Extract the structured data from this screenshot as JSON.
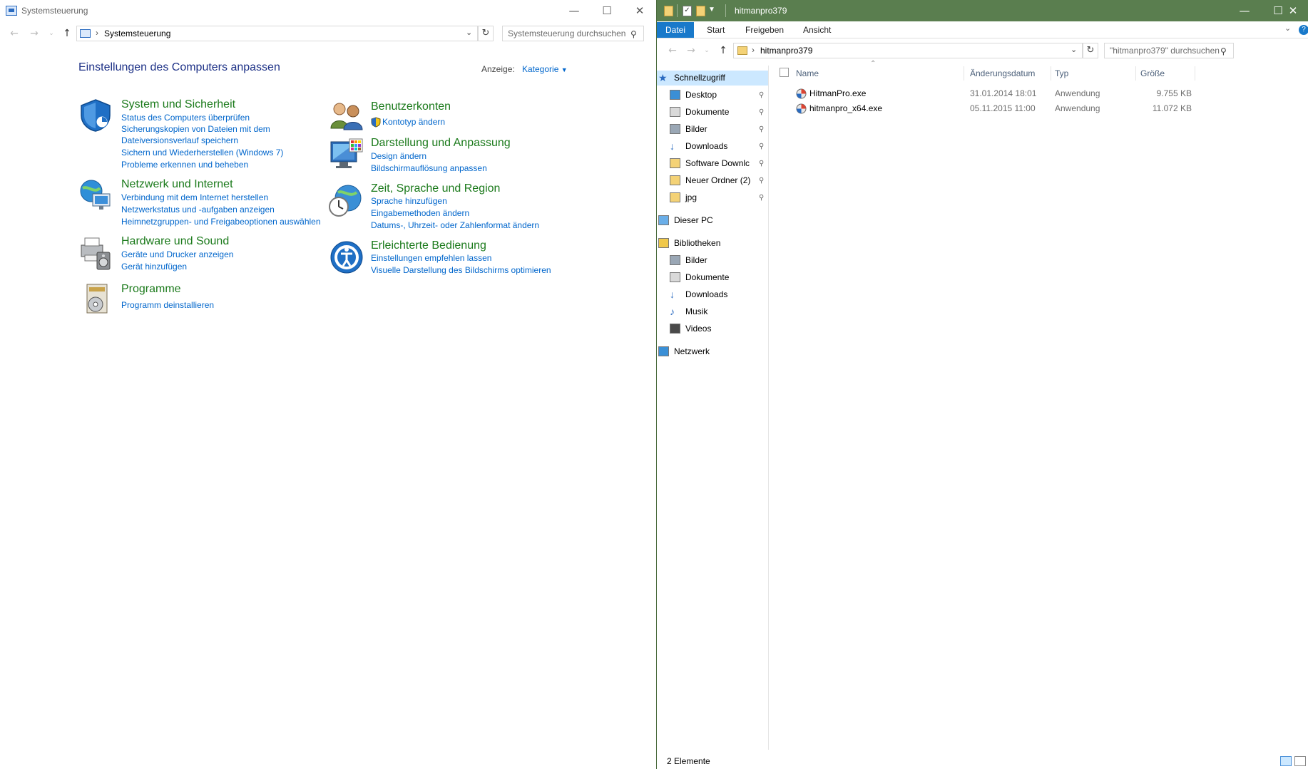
{
  "control_panel": {
    "title": "Systemsteuerung",
    "address_path": "Systemsteuerung",
    "search_placeholder": "Systemsteuerung durchsuchen",
    "heading": "Einstellungen des Computers anpassen",
    "view_label": "Anzeige:",
    "view_value": "Kategorie",
    "categories": [
      {
        "title": "System und Sicherheit",
        "icon": "shield-icon",
        "links": [
          "Status des Computers überprüfen",
          "Sicherungskopien von Dateien mit dem",
          "Dateiversionsverlauf speichern",
          "Sichern und Wiederherstellen (Windows 7)",
          "Probleme erkennen und beheben"
        ]
      },
      {
        "title": "Netzwerk und Internet",
        "icon": "network-globe-icon",
        "links": [
          "Verbindung mit dem Internet herstellen",
          "Netzwerkstatus und -aufgaben anzeigen",
          "Heimnetzgruppen- und Freigabeoptionen auswählen"
        ]
      },
      {
        "title": "Hardware und Sound",
        "icon": "printer-speaker-icon",
        "links": [
          "Geräte und Drucker anzeigen",
          "Gerät hinzufügen"
        ]
      },
      {
        "title": "Programme",
        "icon": "programs-icon",
        "links": [
          "Programm deinstallieren"
        ]
      },
      {
        "title": "Benutzerkonten",
        "icon": "users-icon",
        "links": [
          "Kontotyp ändern"
        ]
      },
      {
        "title": "Darstellung und Anpassung",
        "icon": "monitor-palette-icon",
        "links": [
          "Design ändern",
          "Bildschirmauflösung anpassen"
        ]
      },
      {
        "title": "Zeit, Sprache und Region",
        "icon": "clock-globe-icon",
        "links": [
          "Sprache hinzufügen",
          "Eingabemethoden ändern",
          "Datums-, Uhrzeit- oder Zahlenformat ändern"
        ]
      },
      {
        "title": "Erleichterte Bedienung",
        "icon": "accessibility-icon",
        "links": [
          "Einstellungen empfehlen lassen",
          "Visuelle Darstellung des Bildschirms optimieren"
        ]
      }
    ]
  },
  "explorer": {
    "title": "hitmanpro379",
    "ribbon_tabs": [
      "Datei",
      "Start",
      "Freigeben",
      "Ansicht"
    ],
    "address_path": "hitmanpro379",
    "search_placeholder": "\"hitmanpro379\" durchsuchen",
    "nav": [
      {
        "label": "Schnellzugriff",
        "icon": "star-icon",
        "selected": true,
        "pinned": false
      },
      {
        "label": "Desktop",
        "icon": "desktop-icon",
        "pinned": true
      },
      {
        "label": "Dokumente",
        "icon": "documents-icon",
        "pinned": true
      },
      {
        "label": "Bilder",
        "icon": "pictures-icon",
        "pinned": true
      },
      {
        "label": "Downloads",
        "icon": "download-arrow-icon",
        "pinned": true
      },
      {
        "label": "Software Downlc",
        "icon": "folder-icon",
        "pinned": true
      },
      {
        "label": "Neuer Ordner (2)",
        "icon": "folder-icon",
        "pinned": true
      },
      {
        "label": "jpg",
        "icon": "folder-icon",
        "pinned": true
      },
      {
        "label": "Dieser PC",
        "icon": "pc-icon"
      },
      {
        "label": "Bibliotheken",
        "icon": "libraries-icon"
      },
      {
        "label": "Bilder",
        "icon": "pictures-icon"
      },
      {
        "label": "Dokumente",
        "icon": "documents-icon"
      },
      {
        "label": "Downloads",
        "icon": "download-arrow-icon"
      },
      {
        "label": "Musik",
        "icon": "music-icon"
      },
      {
        "label": "Videos",
        "icon": "videos-icon"
      },
      {
        "label": "Netzwerk",
        "icon": "network-icon"
      }
    ],
    "columns": {
      "name": "Name",
      "date": "Änderungsdatum",
      "type": "Typ",
      "size": "Größe"
    },
    "files": [
      {
        "name": "HitmanPro.exe",
        "date": "31.01.2014 18:01",
        "type": "Anwendung",
        "size": "9.755 KB"
      },
      {
        "name": "hitmanpro_x64.exe",
        "date": "05.11.2015 11:00",
        "type": "Anwendung",
        "size": "11.072 KB"
      }
    ],
    "status": "2 Elemente"
  },
  "colors": {
    "accent_green_title": "#5a7e4f",
    "link_blue": "#0066cc",
    "category_green": "#1b7a1b",
    "ribbon_file_tab": "#1979ca"
  }
}
